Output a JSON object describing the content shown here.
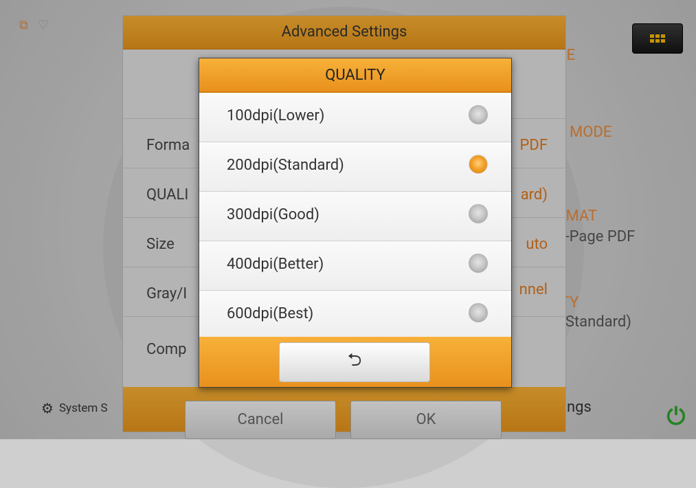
{
  "background": {
    "right_panel": {
      "mode_fragment": "DE",
      "color_mode_fragment": "R MODE",
      "format_title_fragment": "RMAT",
      "format_value_fragment": "ti-Page PDF",
      "quality_title_fragment": "ITY",
      "quality_value_fragment": "i(Standard)"
    },
    "bottom_left_label": "System S",
    "bottom_right_label": "ngs"
  },
  "advanced_settings": {
    "title": "Advanced Settings",
    "rows": [
      {
        "label": "Forma",
        "value": "PDF"
      },
      {
        "label": "QUALI",
        "value": "ard)"
      },
      {
        "label": "Size",
        "value": "uto"
      },
      {
        "label": "Gray/I",
        "value": "nnel"
      },
      {
        "label": "Comp",
        "value": ""
      }
    ],
    "cancel_label": "Cancel",
    "ok_label": "OK"
  },
  "quality_dialog": {
    "title": "QUALITY",
    "options": [
      {
        "label": "100dpi(Lower)",
        "selected": false
      },
      {
        "label": "200dpi(Standard)",
        "selected": true
      },
      {
        "label": "300dpi(Good)",
        "selected": false
      },
      {
        "label": "400dpi(Better)",
        "selected": false
      },
      {
        "label": "600dpi(Best)",
        "selected": false
      }
    ],
    "back_icon": "back-arrow-icon"
  },
  "colors": {
    "accent_orange": "#e8911c",
    "selected_radio": "#f3a12b",
    "power_green": "#2da02d"
  }
}
